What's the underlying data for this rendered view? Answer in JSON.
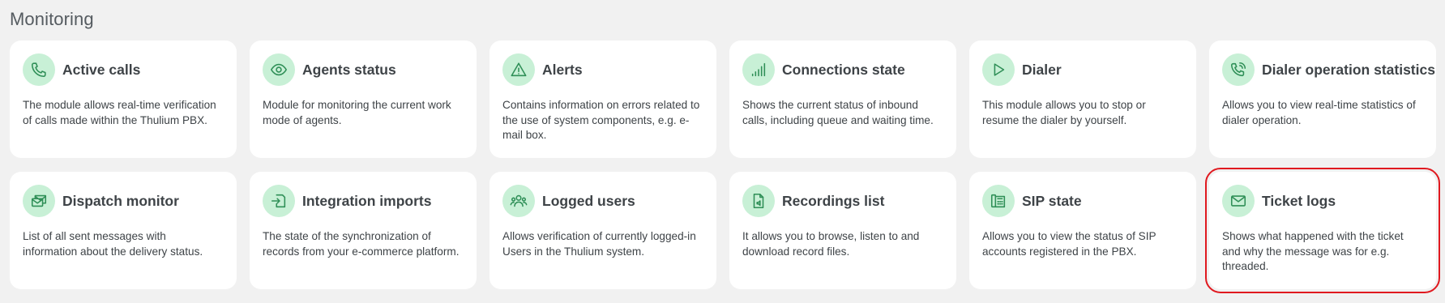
{
  "section": {
    "title": "Monitoring"
  },
  "cards": [
    {
      "title": "Active calls",
      "description": "The module allows real-time verification of calls made within the Thulium PBX.",
      "icon": "phone-icon"
    },
    {
      "title": "Agents status",
      "description": "Module for monitoring the current work mode of agents.",
      "icon": "eye-icon"
    },
    {
      "title": "Alerts",
      "description": "Contains information on errors related to the use of system components, e.g. e-mail box.",
      "icon": "warning-icon"
    },
    {
      "title": "Connections state",
      "description": "Shows the current status of inbound calls, including queue and waiting time.",
      "icon": "signal-bars-icon"
    },
    {
      "title": "Dialer",
      "description": "This module allows you to stop or resume the dialer by yourself.",
      "icon": "play-icon"
    },
    {
      "title": "Dialer operation statistics",
      "description": "Allows you to view real-time statistics of dialer operation.",
      "icon": "phone-chart-icon"
    },
    {
      "title": "Dispatch monitor",
      "description": "List of all sent messages with information about the delivery status.",
      "icon": "envelopes-icon"
    },
    {
      "title": "Integration imports",
      "description": "The state of the synchronization of records from your e-commerce platform.",
      "icon": "import-icon"
    },
    {
      "title": "Logged users",
      "description": "Allows verification of currently logged-in Users in the Thulium system.",
      "icon": "users-icon"
    },
    {
      "title": "Recordings list",
      "description": "It allows you to browse, listen to and download record files.",
      "icon": "audio-file-icon"
    },
    {
      "title": "SIP state",
      "description": "Allows you to view the status of SIP accounts registered in the PBX.",
      "icon": "desk-phone-icon"
    },
    {
      "title": "Ticket logs",
      "description": "Shows what happened with the ticket and why the message was for e.g. threaded.",
      "icon": "envelope-icon",
      "highlighted": true
    }
  ]
}
